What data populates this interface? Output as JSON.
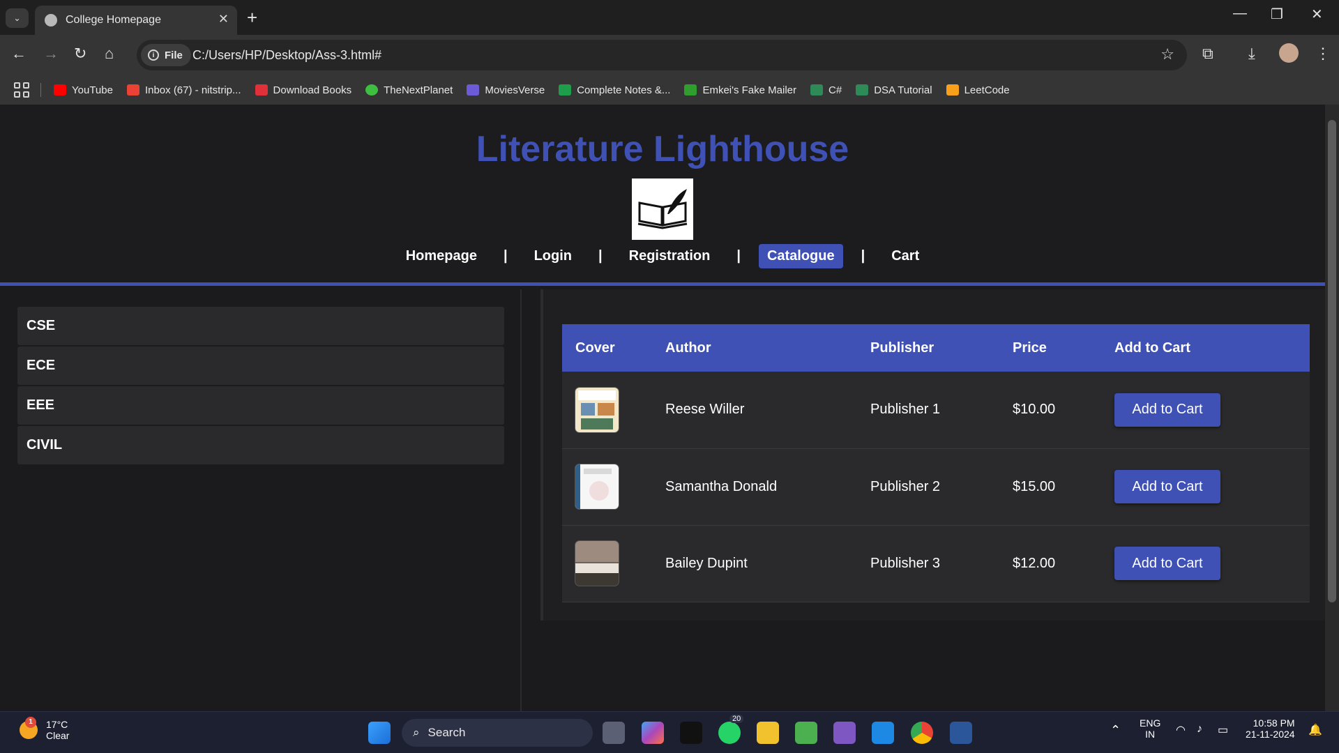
{
  "browser": {
    "tab_title": "College Homepage",
    "file_chip": "File",
    "url": "C:/Users/HP/Desktop/Ass-3.html#",
    "bookmarks": [
      {
        "label": "YouTube",
        "color": "#ff0000"
      },
      {
        "label": "Inbox (67) - nitstrip...",
        "color": "#ea4335"
      },
      {
        "label": "Download Books",
        "color": "#e0303a"
      },
      {
        "label": "TheNextPlanet",
        "color": "#3fbf3f"
      },
      {
        "label": "MoviesVerse",
        "color": "#6b5bd6"
      },
      {
        "label": "Complete Notes &...",
        "color": "#1e9e4a"
      },
      {
        "label": "Emkei's Fake Mailer",
        "color": "#2f9e2f"
      },
      {
        "label": "C#",
        "color": "#2e8b57"
      },
      {
        "label": "DSA Tutorial",
        "color": "#2e8b57"
      },
      {
        "label": "LeetCode",
        "color": "#f89f1b"
      }
    ]
  },
  "site": {
    "title": "Literature Lighthouse",
    "nav": {
      "homepage": "Homepage",
      "login": "Login",
      "registration": "Registration",
      "catalogue": "Catalogue",
      "cart": "Cart",
      "separator": "|"
    },
    "accent": "#3f51b5"
  },
  "sidebar": {
    "categories": [
      "CSE",
      "ECE",
      "EEE",
      "CIVIL"
    ]
  },
  "catalogue": {
    "columns": [
      "Cover",
      "Author",
      "Publisher",
      "Price",
      "Add to Cart"
    ],
    "rows": [
      {
        "author": "Reese Willer",
        "publisher": "Publisher 1",
        "price": "$10.00",
        "button": "Add to Cart"
      },
      {
        "author": "Samantha Donald",
        "publisher": "Publisher 2",
        "price": "$15.00",
        "button": "Add to Cart"
      },
      {
        "author": "Bailey Dupint",
        "publisher": "Publisher 3",
        "price": "$12.00",
        "button": "Add to Cart"
      }
    ]
  },
  "taskbar": {
    "weather_temp": "17°C",
    "weather_desc": "Clear",
    "weather_badge": "1",
    "search_label": "Search",
    "whatsapp_badge": "20",
    "lang_line1": "ENG",
    "lang_line2": "IN",
    "time": "10:58 PM",
    "date": "21-11-2024"
  }
}
